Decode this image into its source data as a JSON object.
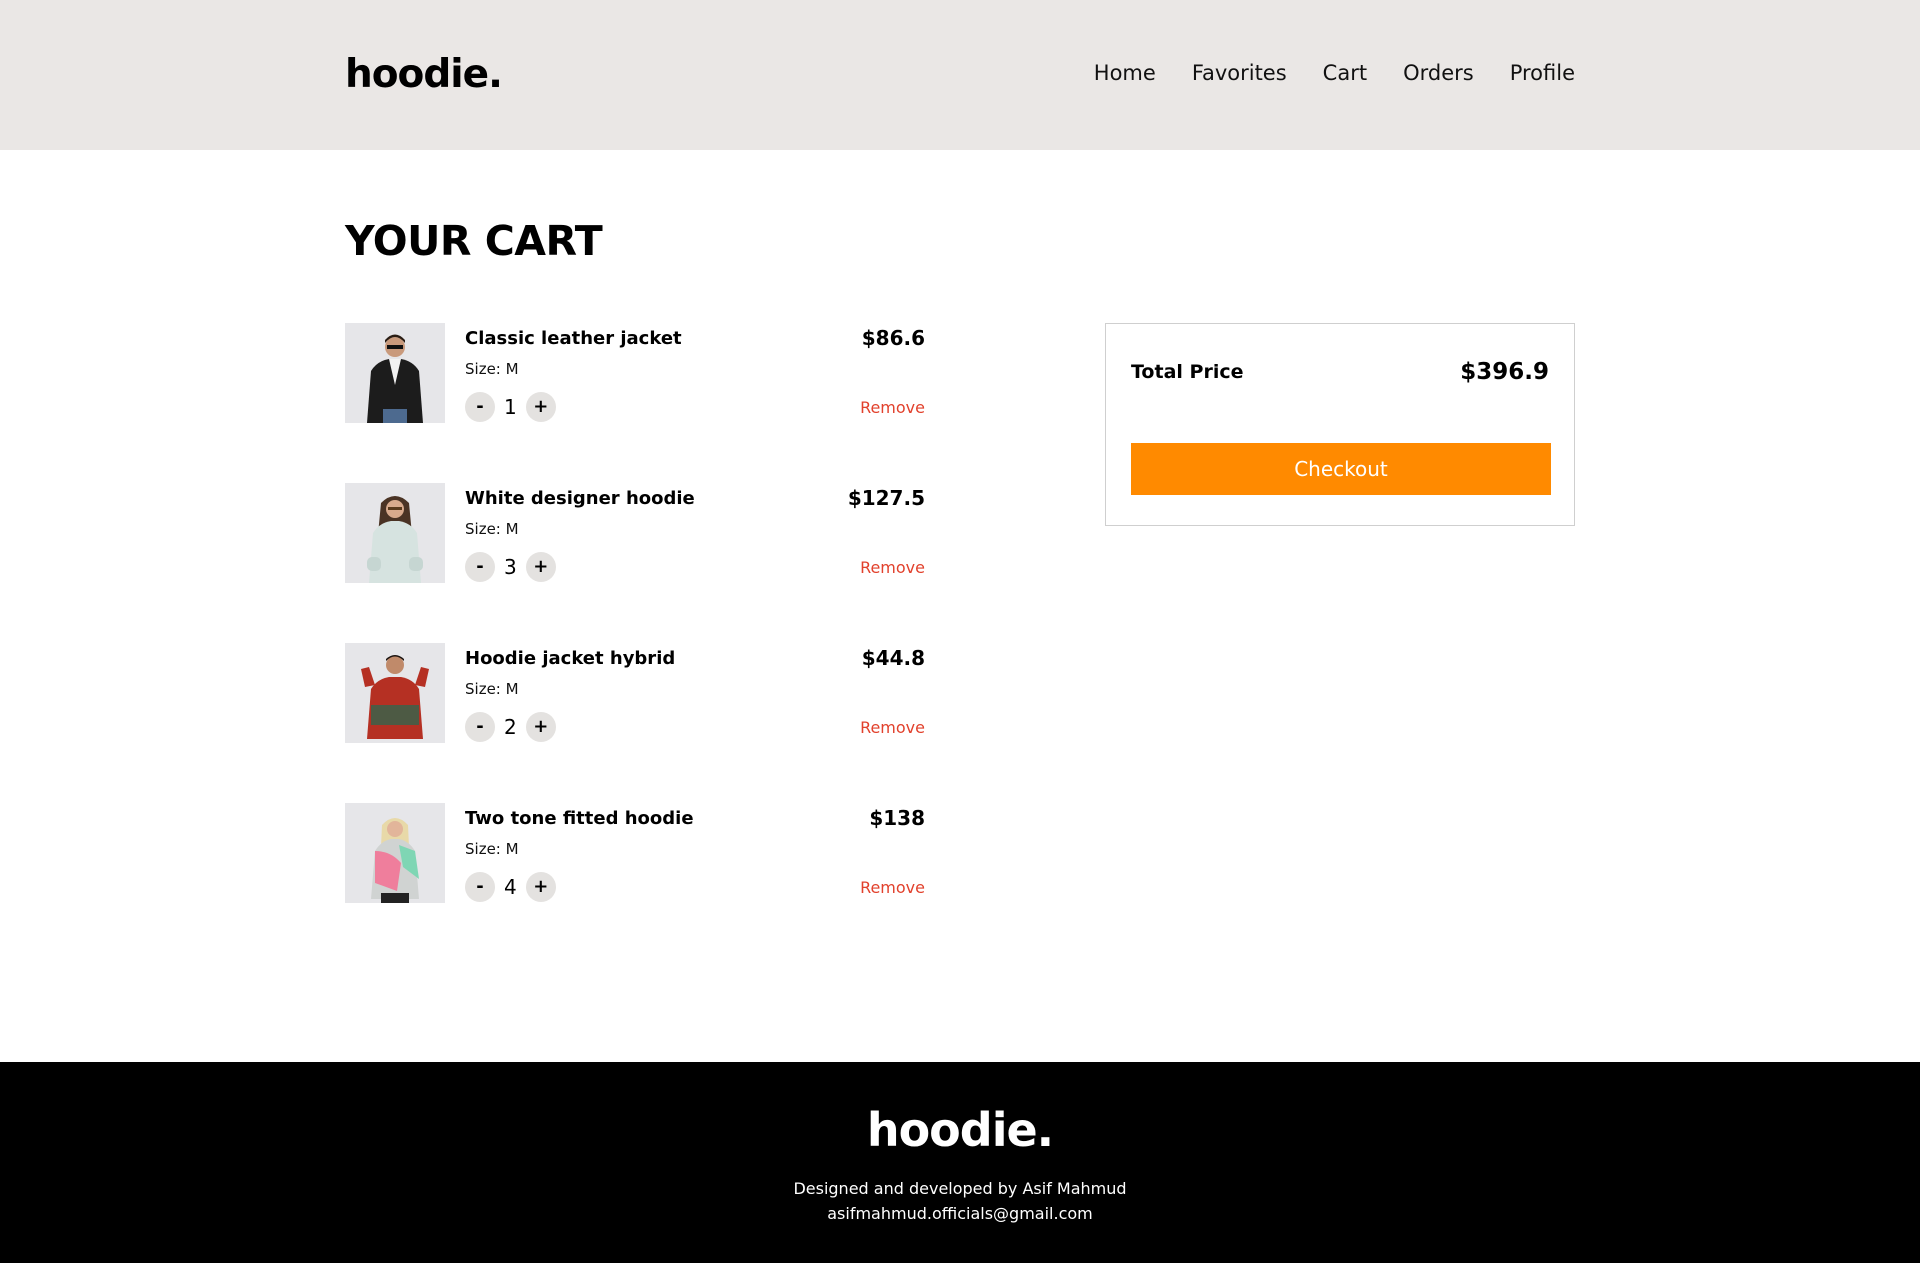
{
  "header": {
    "logo": "hoodie.",
    "nav": [
      "Home",
      "Favorites",
      "Cart",
      "Orders",
      "Profile"
    ]
  },
  "page_title": "YOUR CART",
  "cart": {
    "items": [
      {
        "name": "Classic leather jacket",
        "size": "Size: M",
        "qty": "1",
        "price": "$86.6",
        "remove": "Remove",
        "minus": "-",
        "plus": "+"
      },
      {
        "name": "White designer hoodie",
        "size": "Size: M",
        "qty": "3",
        "price": "$127.5",
        "remove": "Remove",
        "minus": "-",
        "plus": "+"
      },
      {
        "name": "Hoodie jacket hybrid",
        "size": "Size: M",
        "qty": "2",
        "price": "$44.8",
        "remove": "Remove",
        "minus": "-",
        "plus": "+"
      },
      {
        "name": "Two tone fitted hoodie",
        "size": "Size: M",
        "qty": "4",
        "price": "$138",
        "remove": "Remove",
        "minus": "-",
        "plus": "+"
      }
    ]
  },
  "summary": {
    "total_label": "Total Price",
    "total_value": "$396.9",
    "checkout_label": "Checkout"
  },
  "footer": {
    "logo": "hoodie.",
    "credit": "Designed and developed by Asif Mahmud",
    "email": "asifmahmud.officials@gmail.com"
  },
  "colors": {
    "header_bg": "#eae7e5",
    "accent": "#ff8a00",
    "remove": "#e2412c",
    "footer_bg": "#000000"
  }
}
